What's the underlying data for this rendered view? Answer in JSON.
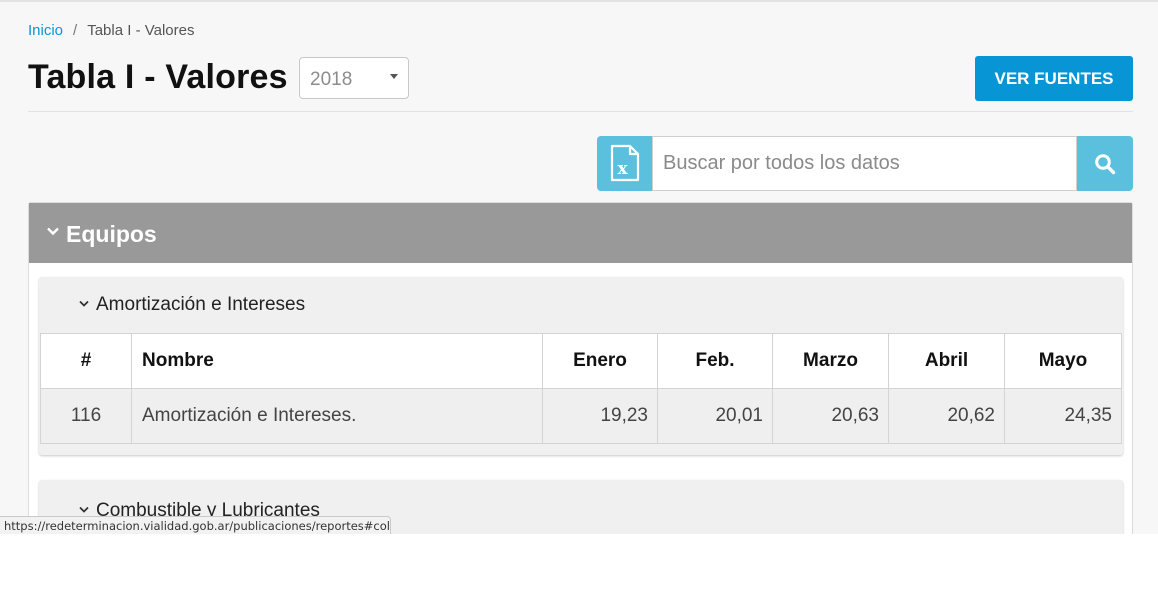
{
  "breadcrumb": {
    "home": "Inicio",
    "separator": "/",
    "current": "Tabla I - Valores"
  },
  "page": {
    "title": "Tabla I - Valores",
    "year_selected": "2018",
    "sources_button": "VER FUENTES"
  },
  "search": {
    "placeholder": "Buscar por todos los datos",
    "value": ""
  },
  "section": {
    "title": "Equipos",
    "subsections": [
      {
        "title": "Amortización e Intereses",
        "columns": [
          "#",
          "Nombre",
          "Enero",
          "Feb.",
          "Marzo",
          "Abril",
          "Mayo"
        ],
        "rows": [
          {
            "num": "116",
            "name": "Amortización e Intereses.",
            "values": [
              "19,23",
              "20,01",
              "20,63",
              "20,62",
              "24,35"
            ]
          }
        ]
      },
      {
        "title": "Combustible y Lubricantes"
      }
    ]
  },
  "status_bar": {
    "url": "https://redeterminacion.vialidad.gob.ar/publicaciones/reportes#collpa..."
  },
  "colors": {
    "accent": "#0895d6",
    "search_accent": "#5bc0de",
    "panel_header": "#999999"
  },
  "icons": {
    "excel": "excel-file-icon",
    "search": "search-icon",
    "chevron": "chevron-down-icon"
  }
}
